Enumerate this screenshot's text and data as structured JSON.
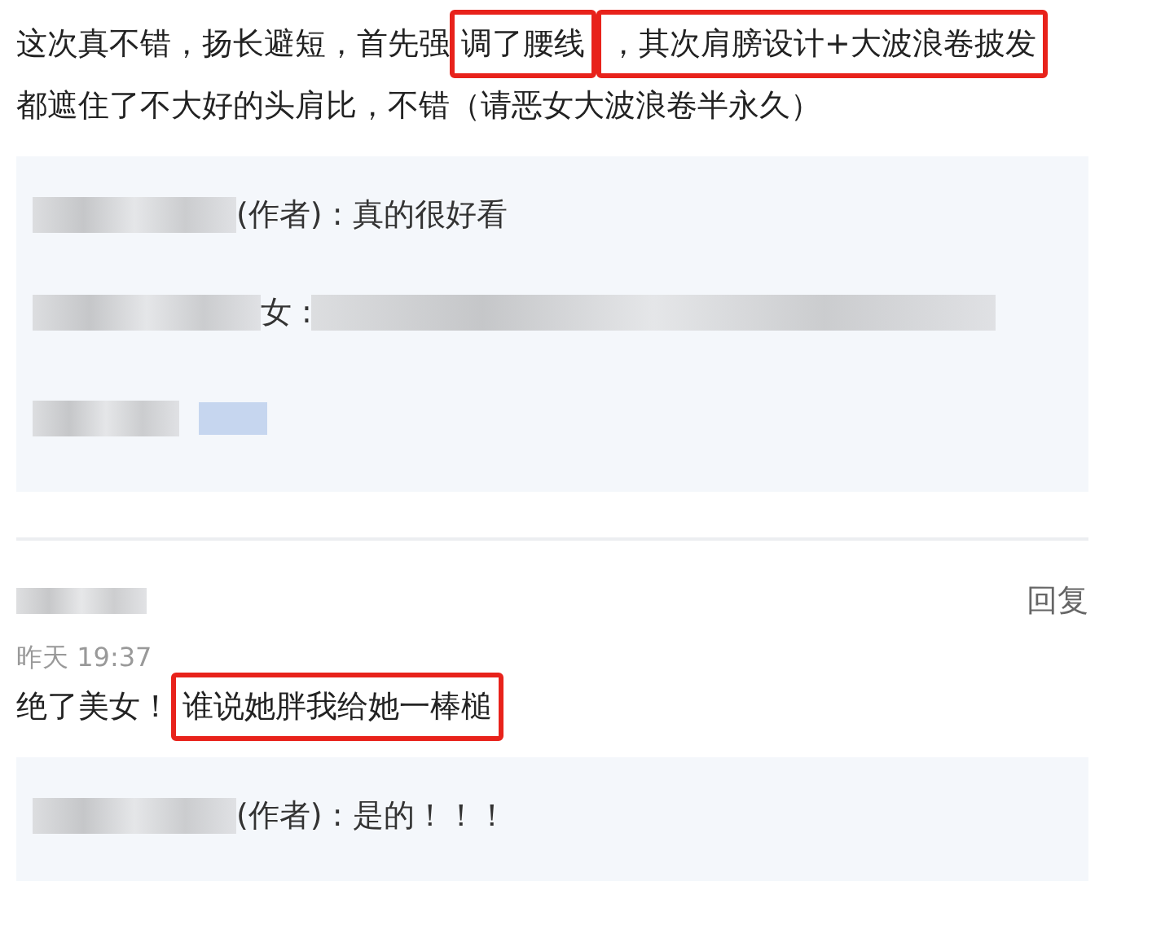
{
  "comments": [
    {
      "lines": [
        [
          {
            "text": "这次真不错，扬长避短，首先强",
            "highlighted": false
          },
          {
            "text": "调了腰线",
            "highlighted": true
          },
          {
            "text": "，其次肩膀设计+大波浪卷披发",
            "highlighted": true
          }
        ],
        [
          {
            "text": "都遮住了不大好的头肩比，不错（请恶女大波浪卷半永久）",
            "highlighted": false
          }
        ]
      ],
      "replies": [
        {
          "kind": "text",
          "text": "(作者) : 真的很好看"
        },
        {
          "kind": "text",
          "text": "女 :"
        },
        {
          "kind": "blurred"
        }
      ]
    },
    {
      "reply_label": "回复",
      "time": "昨天 19:37",
      "lines": [
        [
          {
            "text": "绝了美女！",
            "highlighted": false
          },
          {
            "text": "谁说她胖我给她一棒槌",
            "highlighted": true
          }
        ]
      ],
      "replies": [
        {
          "kind": "text",
          "text": "(作者) : 是的！！！"
        }
      ]
    }
  ]
}
